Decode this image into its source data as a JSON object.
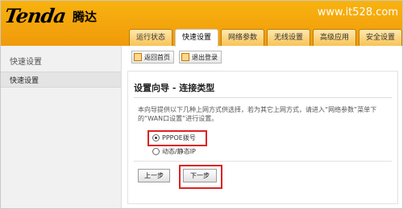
{
  "brand": {
    "logo_word": "Tenda",
    "logo_cn": "腾达",
    "watermark": "www.it528.com"
  },
  "tabs": [
    {
      "label": "运行状态",
      "active": false
    },
    {
      "label": "快速设置",
      "active": true
    },
    {
      "label": "网络参数",
      "active": false
    },
    {
      "label": "无线设置",
      "active": false
    },
    {
      "label": "高级应用",
      "active": false
    },
    {
      "label": "安全设置",
      "active": false
    }
  ],
  "sidebar": {
    "title": "快速设置",
    "items": [
      {
        "label": "快速设置"
      }
    ]
  },
  "toolbar": {
    "home_label": "返回首页",
    "logout_label": "退出登录"
  },
  "wizard": {
    "title": "设置向导 - 连接类型",
    "description": "本向导提供以下几种上网方式供选择，若为其它上网方式，请进入“网络参数”菜单下的“WAN口设置”进行设置。",
    "options": [
      {
        "label": "PPPOE拨号",
        "selected": true
      },
      {
        "label": "动态/静态IP",
        "selected": false
      }
    ],
    "prev_label": "上一步",
    "next_label": "下一步"
  },
  "colors": {
    "header_orange": "#f5a60c",
    "highlight_red": "#dd2222"
  }
}
